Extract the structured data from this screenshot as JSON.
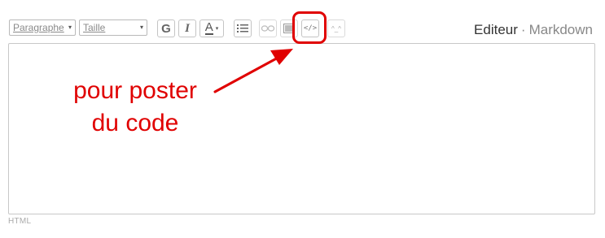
{
  "toolbar": {
    "paragraph_select": "Paragraphe",
    "size_select": "Taille",
    "bold_label": "G",
    "italic_label": "I",
    "color_label": "A",
    "code_label": "</>",
    "emoji_label": "^_^"
  },
  "mode_tabs": {
    "active": "Editeur",
    "separator": "·",
    "inactive": "Markdown"
  },
  "editor": {
    "content": ""
  },
  "footer": {
    "format_label": "HTML"
  },
  "annotation": {
    "line1": "pour poster",
    "line2": "du code",
    "color": "#e00000"
  }
}
